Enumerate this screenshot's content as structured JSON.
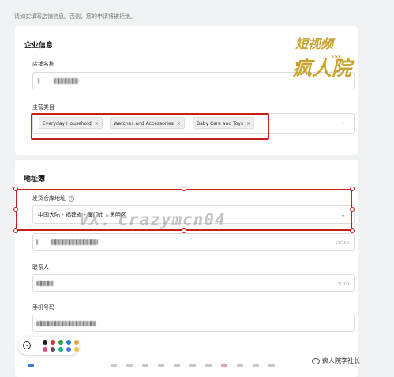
{
  "notice": "请如实填写店铺信息。否则，您的申请将被拒绝。",
  "company": {
    "title": "企业信息",
    "store_name_label": "店铺名称",
    "category_label": "主营类目",
    "tags": [
      "Everyday Household",
      "Watches and Accessories",
      "Baby Care and Toys"
    ]
  },
  "address": {
    "title": "地址簿",
    "warehouse_label": "发货仓库地址",
    "warehouse_value": "中国大陆 - 福建省 - 厦门市 - 思明区",
    "detail_counter": "17/150",
    "contact_label": "联系人",
    "contact_counter": "3/100",
    "phone_label": "手机号码"
  },
  "watermark_vx": "VX：crazymcn04",
  "seal": {
    "top": "短视频",
    "bottom": "疯人院",
    "small": "EST"
  },
  "credit": "疯人院李社长",
  "icons": {
    "info": "info-icon",
    "chevron": "chevron-down-icon",
    "remove": "close-icon"
  },
  "colors": {
    "highlight": "#c81e1e",
    "seal": "#c9a32e"
  },
  "toolbar": {
    "swatches": [
      "#1e1e1e",
      "#e03131",
      "#2f9e44",
      "#1c7ed6",
      "#e8a33d",
      "#e64980",
      "#555555",
      "#12b886",
      "#4c6ef5",
      "#f0c040"
    ]
  }
}
